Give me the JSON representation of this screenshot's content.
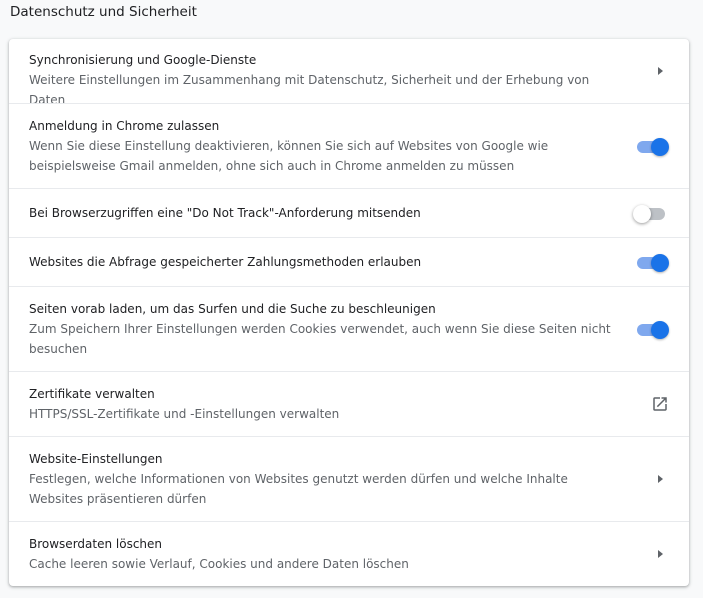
{
  "section": {
    "title": "Datenschutz und Sicherheit"
  },
  "rows": [
    {
      "title": "Synchronisierung und Google-Dienste",
      "sub": "Weitere Einstellungen im Zusammenhang mit Datenschutz, Sicherheit und der Erhebung von Daten",
      "control": "arrow"
    },
    {
      "title": "Anmeldung in Chrome zulassen",
      "sub": "Wenn Sie diese Einstellung deaktivieren, können Sie sich auf Websites von Google wie beispielsweise Gmail anmelden, ohne sich auch in Chrome anmelden zu müssen",
      "control": "toggle",
      "on": true
    },
    {
      "title": "Bei Browserzugriffen eine \"Do Not Track\"-Anforderung mitsenden",
      "sub": "",
      "control": "toggle",
      "on": false
    },
    {
      "title": "Websites die Abfrage gespeicherter Zahlungsmethoden erlauben",
      "sub": "",
      "control": "toggle",
      "on": true
    },
    {
      "title": "Seiten vorab laden, um das Surfen und die Suche zu beschleunigen",
      "sub": "Zum Speichern Ihrer Einstellungen werden Cookies verwendet, auch wenn Sie diese Seiten nicht besuchen",
      "control": "toggle",
      "on": true
    },
    {
      "title": "Zertifikate verwalten",
      "sub": "HTTPS/SSL-Zertifikate und -Einstellungen verwalten",
      "control": "external"
    },
    {
      "title": "Website-Einstellungen",
      "sub": "Festlegen, welche Informationen von Websites genutzt werden dürfen und welche Inhalte Websites präsentieren dürfen",
      "control": "arrow"
    },
    {
      "title": "Browserdaten löschen",
      "sub": "Cache leeren sowie Verlauf, Cookies und andere Daten löschen",
      "control": "arrow"
    }
  ],
  "colors": {
    "accent": "#1a73e8",
    "accent_track": "#7fa8ee",
    "off_track": "#bdc1c6",
    "divider": "#e8eaed"
  },
  "icons": {
    "arrow": "arrow-right-icon",
    "external": "open-in-new-icon"
  }
}
